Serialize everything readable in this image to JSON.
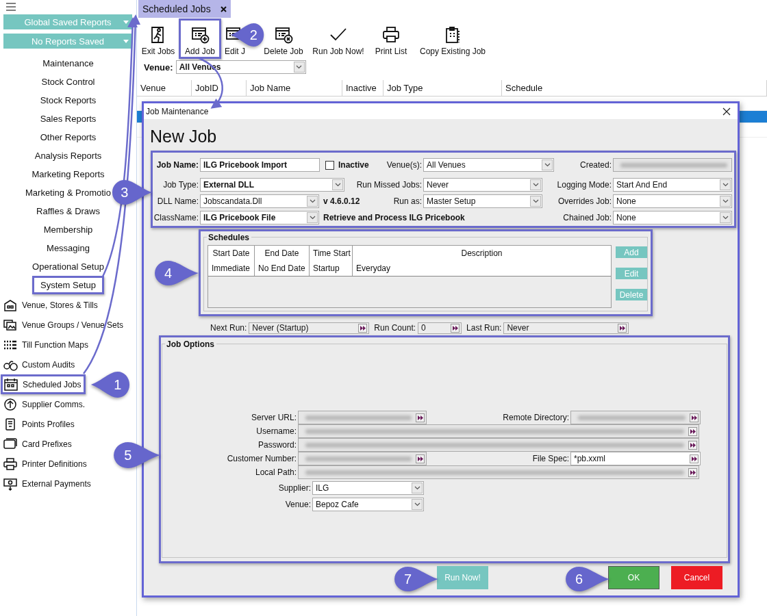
{
  "sidebar": {
    "dropdowns": [
      {
        "label": "Global Saved Reports"
      },
      {
        "label": "No Reports Saved"
      }
    ],
    "sections": [
      {
        "label": "Maintenance",
        "highlighted": false
      },
      {
        "label": "Stock Control",
        "highlighted": false
      },
      {
        "label": "Stock Reports",
        "highlighted": false
      },
      {
        "label": "Sales Reports",
        "highlighted": false
      },
      {
        "label": "Other Reports",
        "highlighted": false
      },
      {
        "label": "Analysis Reports",
        "highlighted": false
      },
      {
        "label": "Marketing Reports",
        "highlighted": false
      },
      {
        "label": "Marketing & Promotio",
        "highlighted": false
      },
      {
        "label": "Raffles & Draws",
        "highlighted": false
      },
      {
        "label": "Membership",
        "highlighted": false
      },
      {
        "label": "Messaging",
        "highlighted": false
      },
      {
        "label": "Operational Setup",
        "highlighted": false
      },
      {
        "label": "System Setup",
        "highlighted": true
      }
    ],
    "tools": [
      {
        "label": "Venue, Stores & Tills",
        "highlighted": false
      },
      {
        "label": "Venue Groups / Venue Sets",
        "highlighted": false
      },
      {
        "label": "Till Function Maps",
        "highlighted": false
      },
      {
        "label": "Custom Audits",
        "highlighted": false
      },
      {
        "label": "Scheduled Jobs",
        "highlighted": true
      },
      {
        "label": "Supplier Comms.",
        "highlighted": false
      },
      {
        "label": "Points Profiles",
        "highlighted": false
      },
      {
        "label": "Card Prefixes",
        "highlighted": false
      },
      {
        "label": "Printer Definitions",
        "highlighted": false
      },
      {
        "label": "External Payments",
        "highlighted": false
      }
    ]
  },
  "tab": {
    "label": "Scheduled Jobs",
    "selected": true
  },
  "toolbar": [
    {
      "label": "Exit Jobs",
      "highlighted": false
    },
    {
      "label": "Add Job",
      "highlighted": true
    },
    {
      "label": "Edit J",
      "highlighted": false
    },
    {
      "label": "Delete Job",
      "highlighted": false
    },
    {
      "label": "Run Job Now!",
      "highlighted": false
    },
    {
      "label": "Print List",
      "highlighted": false
    },
    {
      "label": "Copy Existing Job",
      "highlighted": false
    }
  ],
  "venue_filter": {
    "label": "Venue:",
    "value": "All Venues"
  },
  "table": {
    "columns": [
      "Venue",
      "JobID",
      "Job Name",
      "Inactive",
      "Job Type",
      "Schedule"
    ],
    "rows": [
      {
        "selected": false
      },
      {
        "selected": true
      },
      {
        "selected": false
      }
    ]
  },
  "dialog": {
    "title": "Job Maintenance",
    "heading": "New Job",
    "highlighted": true,
    "general": {
      "highlighted": true,
      "job_name": {
        "label": "Job Name:",
        "value": "ILG Pricebook Import"
      },
      "inactive": {
        "label": "Inactive",
        "checked": false
      },
      "venues": {
        "label": "Venue(s):",
        "value": "All Venues"
      },
      "created": {
        "label": "Created:",
        "blurred": true
      },
      "job_type": {
        "label": "Job Type:",
        "value": "External DLL"
      },
      "run_missed": {
        "label": "Run Missed Jobs:",
        "value": "Never"
      },
      "logging_mode": {
        "label": "Logging Mode:",
        "value": "Start And End"
      },
      "dll_name": {
        "label": "DLL Name:",
        "value": "Jobscandata.Dll"
      },
      "version": "v 4.6.0.12",
      "run_as": {
        "label": "Run as:",
        "value": "Master Setup"
      },
      "overrides": {
        "label": "Overrides Job:",
        "value": "None"
      },
      "class_name": {
        "label": "ClassName:",
        "value": "ILG Pricebook File"
      },
      "description": "Retrieve and Process ILG Pricebook",
      "chained": {
        "label": "Chained Job:",
        "value": "None"
      }
    },
    "schedules": {
      "title": "Schedules",
      "highlighted": true,
      "columns": [
        "Start Date",
        "End Date",
        "Time Start",
        "Description"
      ],
      "rows": [
        [
          "Immediate",
          "No End Date",
          "Startup",
          "Everyday"
        ]
      ],
      "buttons": [
        "Add",
        "Edit",
        "Delete"
      ]
    },
    "run_info": [
      {
        "label": "Next Run:",
        "value": "Never (Startup)"
      },
      {
        "label": "Run Count:",
        "value": "0"
      },
      {
        "label": "Last Run:",
        "value": "Never"
      }
    ],
    "job_options": {
      "title": "Job Options",
      "highlighted": true,
      "rows": [
        [
          {
            "label": "Server URL:",
            "blurred": true
          },
          {
            "label": "Remote Directory:",
            "blurred": true
          }
        ],
        [
          {
            "label": "Username:",
            "blurred": true
          }
        ],
        [
          {
            "label": "Password:",
            "blurred": true
          }
        ],
        [
          {
            "label": "Customer Number:",
            "blurred": true
          },
          {
            "label": "File Spec:",
            "value": "*pb.xxml",
            "blurred": false
          }
        ],
        [
          {
            "label": "Local Path:",
            "blurred": true
          }
        ]
      ],
      "selects": [
        {
          "label": "Supplier:",
          "value": "ILG"
        },
        {
          "label": "Venue:",
          "value": "Bepoz Cafe"
        }
      ]
    },
    "buttons": [
      {
        "label": "Run Now!",
        "kind": "run"
      },
      {
        "label": "OK",
        "kind": "ok"
      },
      {
        "label": "Cancel",
        "kind": "cancel"
      }
    ]
  },
  "callouts": [
    {
      "number": "1",
      "kind": "left"
    },
    {
      "number": "2",
      "kind": "left"
    },
    {
      "number": "3",
      "kind": "right"
    },
    {
      "number": "4",
      "kind": "right"
    },
    {
      "number": "5",
      "kind": "right"
    },
    {
      "number": "6",
      "kind": "right"
    },
    {
      "number": "7",
      "kind": "right"
    }
  ]
}
